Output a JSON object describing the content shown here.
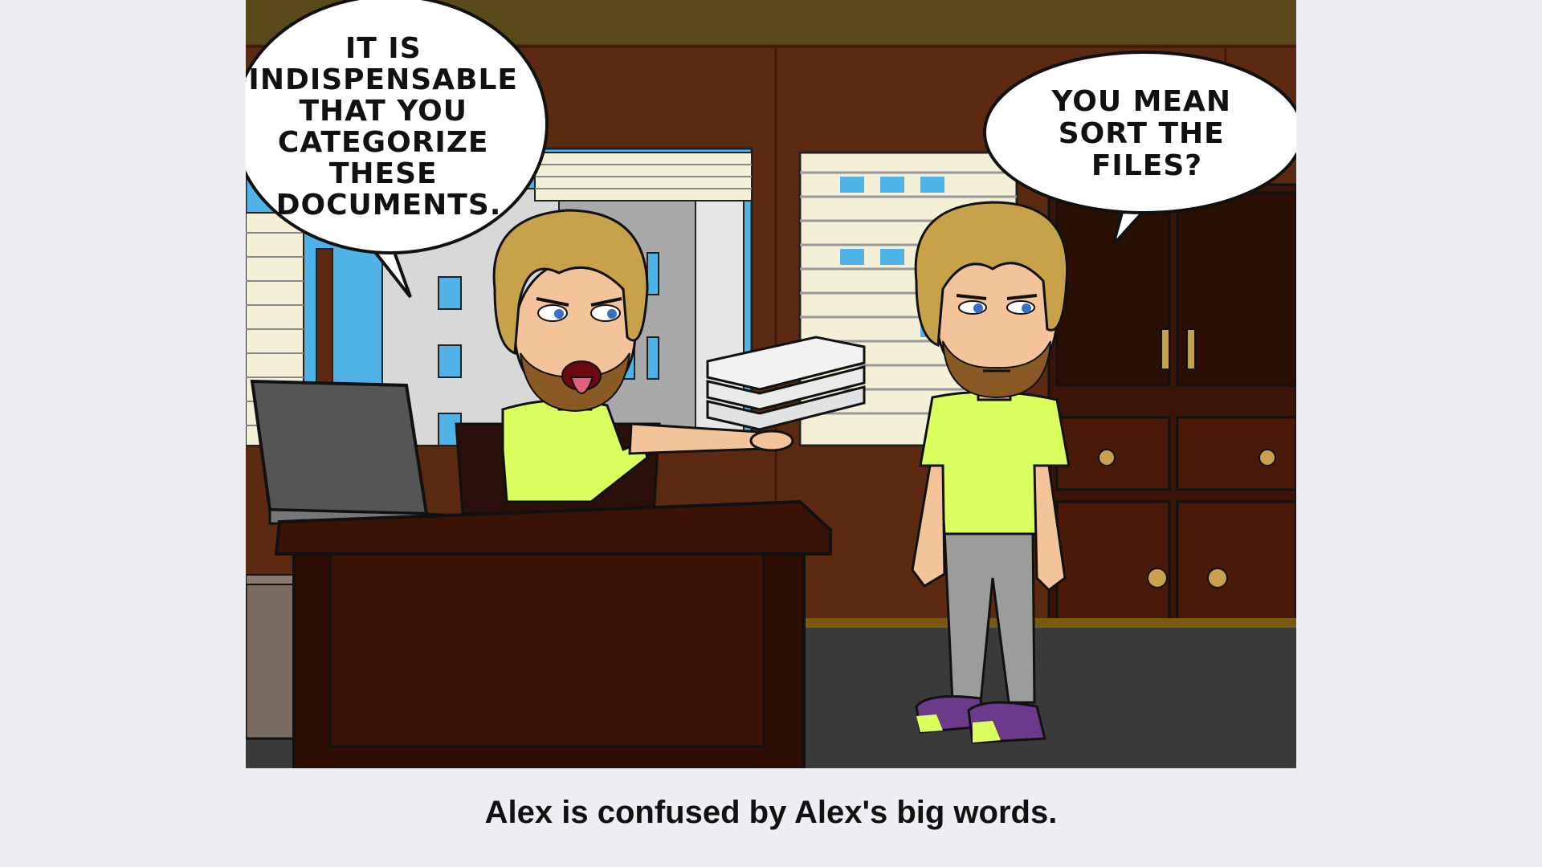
{
  "comic": {
    "speech_left": {
      "lines": [
        "IT IS",
        "INDISPENSABLE",
        "THAT YOU",
        "CATEGORIZE",
        "THESE",
        "DOCUMENTS."
      ]
    },
    "speech_right": {
      "lines": [
        "YOU MEAN",
        "SORT THE",
        "FILES?"
      ]
    },
    "colors": {
      "wall": "#5c2a10",
      "ceiling": "#5a4a1a",
      "floor": "#3a3a3a",
      "shirt": "#dbff5e",
      "hair": "#c7a24a",
      "desk": "#3a1206",
      "pants": "#9a9d9a",
      "shoes_purple": "#6b3a8a"
    }
  },
  "caption": "Alex is confused by Alex's big words."
}
